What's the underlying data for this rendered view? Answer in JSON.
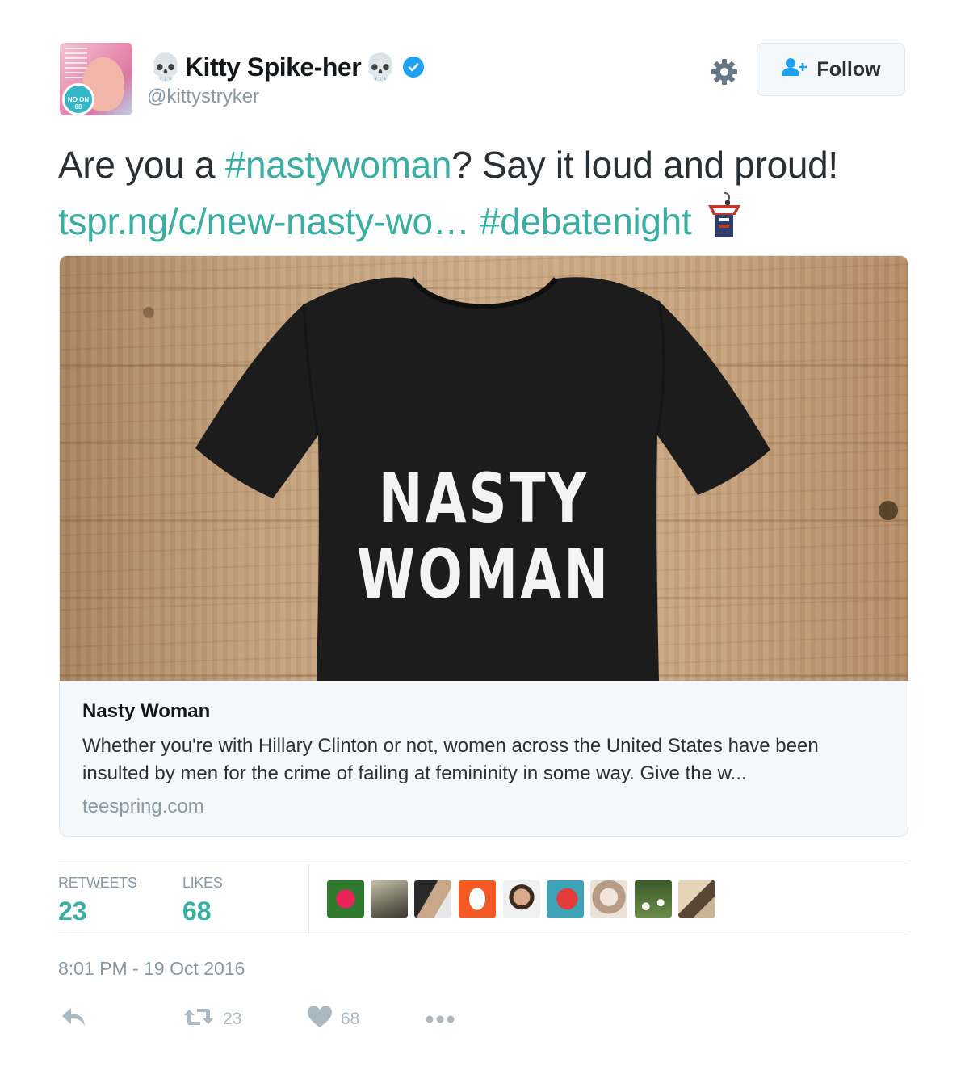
{
  "user": {
    "display_name": "Kitty Spike-her",
    "name_emoji": "💀",
    "handle": "@kittystryker",
    "verified": true,
    "avatar_sign_text": "NO ON 60"
  },
  "header": {
    "follow_label": "Follow",
    "icons": [
      "gear-icon",
      "follow-person-icon",
      "verified-icon"
    ]
  },
  "tweet": {
    "text_before": "Are you a ",
    "hashtag1": "#nastywoman",
    "text_after": "? Say it loud and proud!",
    "link": "tspr.ng/c/new-nasty-wo…",
    "hashtag2": "#debatenight",
    "trailing_emoji": "podium-icon"
  },
  "card": {
    "image_shirt_line1": "NASTY",
    "image_shirt_line2": "WOMAN",
    "title": "Nasty Woman",
    "description": "Whether you're with Hillary Clinton or not, women across the United States have been insulted by men for the crime of failing at femininity in some way. Give the w...",
    "domain": "teespring.com"
  },
  "stats": {
    "retweets_label": "RETWEETS",
    "retweets_value": "23",
    "likes_label": "LIKES",
    "likes_value": "68",
    "likers_count_shown": 9
  },
  "timestamp": "8:01 PM - 19 Oct 2016",
  "actions": {
    "reply_icon": "reply-icon",
    "retweet_icon": "retweet-icon",
    "retweet_count": "23",
    "like_icon": "heart-icon",
    "like_count": "68",
    "more_icon": "more-icon"
  },
  "colors": {
    "link": "#3aaea1",
    "verified": "#1da1f2",
    "muted": "#8899a6",
    "action_icon": "#aab8c2",
    "border": "#e1e8ed"
  }
}
